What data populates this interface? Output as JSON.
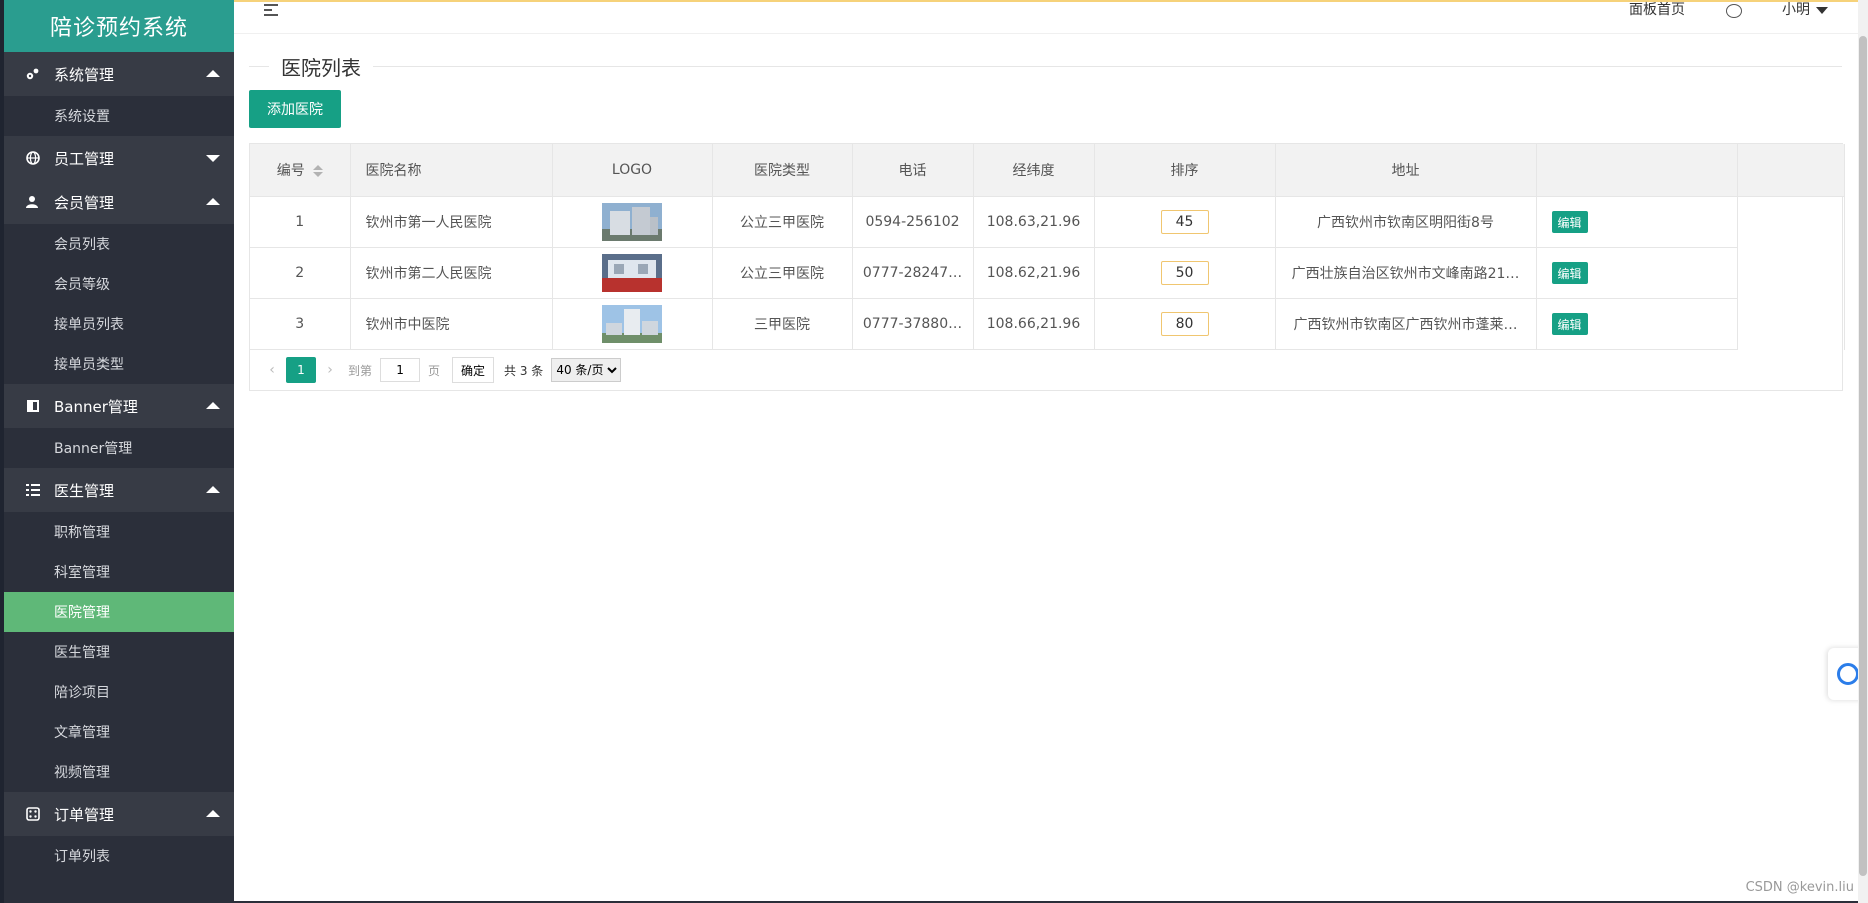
{
  "app": {
    "title": "陪诊预约系统"
  },
  "sidebar": {
    "groups": [
      {
        "label": "系统管理",
        "icon": "gears-icon",
        "expanded": true,
        "items": [
          "系统设置"
        ]
      },
      {
        "label": "员工管理",
        "icon": "globe-icon",
        "expanded": false,
        "items": []
      },
      {
        "label": "会员管理",
        "icon": "user-icon",
        "expanded": true,
        "items": [
          "会员列表",
          "会员等级",
          "接单员列表",
          "接单员类型"
        ]
      },
      {
        "label": "Banner管理",
        "icon": "banner-icon",
        "expanded": true,
        "items": [
          "Banner管理"
        ]
      },
      {
        "label": "医生管理",
        "icon": "list-icon",
        "expanded": true,
        "items": [
          "职称管理",
          "科室管理",
          "医院管理",
          "医生管理",
          "陪诊项目",
          "文章管理",
          "视频管理"
        ]
      },
      {
        "label": "订单管理",
        "icon": "dice-icon",
        "expanded": true,
        "items": [
          "订单列表"
        ]
      }
    ],
    "active_item": "医院管理"
  },
  "header": {
    "dashboard_link": "面板首页",
    "user_name": "小明"
  },
  "page": {
    "title": "医院列表",
    "add_button": "添加医院"
  },
  "table": {
    "columns": [
      "编号",
      "医院名称",
      "LOGO",
      "医院类型",
      "电话",
      "经纬度",
      "排序",
      "地址",
      ""
    ],
    "rows": [
      {
        "id": "1",
        "name": "钦州市第一人民医院",
        "type": "公立三甲医院",
        "phone": "0594-256102",
        "coords": "108.63,21.96",
        "sort": "45",
        "address": "广西钦州市钦南区明阳街8号",
        "action": "编辑"
      },
      {
        "id": "2",
        "name": "钦州市第二人民医院",
        "type": "公立三甲医院",
        "phone": "0777-28247…",
        "coords": "108.62,21.96",
        "sort": "50",
        "address": "广西壮族自治区钦州市文峰南路21…",
        "action": "编辑"
      },
      {
        "id": "3",
        "name": "钦州市中医院",
        "type": "三甲医院",
        "phone": "0777-37880…",
        "coords": "108.66,21.96",
        "sort": "80",
        "address": "广西钦州市钦南区广西钦州市蓬莱…",
        "action": "编辑"
      }
    ]
  },
  "pager": {
    "current": "1",
    "goto_label": "到第",
    "page_unit": "页",
    "goto_value": "1",
    "confirm": "确定",
    "total": "共 3 条",
    "page_size": "40 条/页"
  },
  "watermark": "CSDN @kevin.liu",
  "colors": {
    "brand": "#16a085",
    "sidebar_bg": "#2b2f3a",
    "active_item": "#5fb878",
    "logo_bg": "#2a9d8f"
  }
}
